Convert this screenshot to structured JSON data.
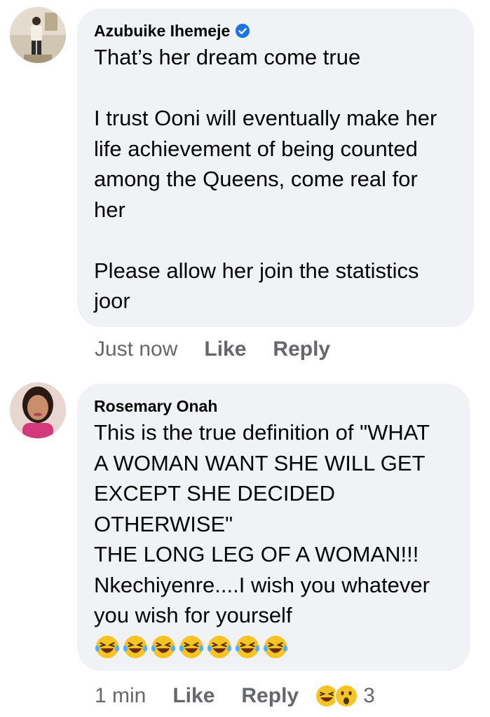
{
  "comments": [
    {
      "author": "Azubuike Ihemeje",
      "verified": true,
      "lines": [
        "That’s her dream come true",
        "",
        "I trust Ooni will eventually make her",
        "life achievement of being counted",
        "among the Queens, come real for",
        "her",
        "",
        "Please allow her join the statistics",
        "joor"
      ],
      "time": "Just now",
      "like_label": "Like",
      "reply_label": "Reply"
    },
    {
      "author": "Rosemary Onah",
      "verified": false,
      "lines": [
        "This is the true definition of \"WHAT",
        "A WOMAN WANT SHE WILL GET",
        "EXCEPT SHE DECIDED",
        "OTHERWISE\"",
        "THE LONG LEG OF A WOMAN!!!",
        "Nkechiyenre....I wish you whatever",
        "you wish for yourself"
      ],
      "emoji_line": [
        "laughing-tears-emoji",
        "laughing-tears-emoji",
        "laughing-tears-emoji",
        "laughing-tears-emoji",
        "laughing-tears-emoji",
        "laughing-tears-emoji",
        "laughing-tears-emoji"
      ],
      "time": "1 min",
      "like_label": "Like",
      "reply_label": "Reply",
      "reactions": {
        "icons": [
          "haha-reaction-icon",
          "wow-reaction-icon"
        ],
        "count": "3"
      }
    }
  ],
  "colors": {
    "bubble": "#f0f2f5",
    "meta_text": "#65676b",
    "verified_blue": "#1b74e4",
    "emoji_yellow": "#f7c325"
  }
}
